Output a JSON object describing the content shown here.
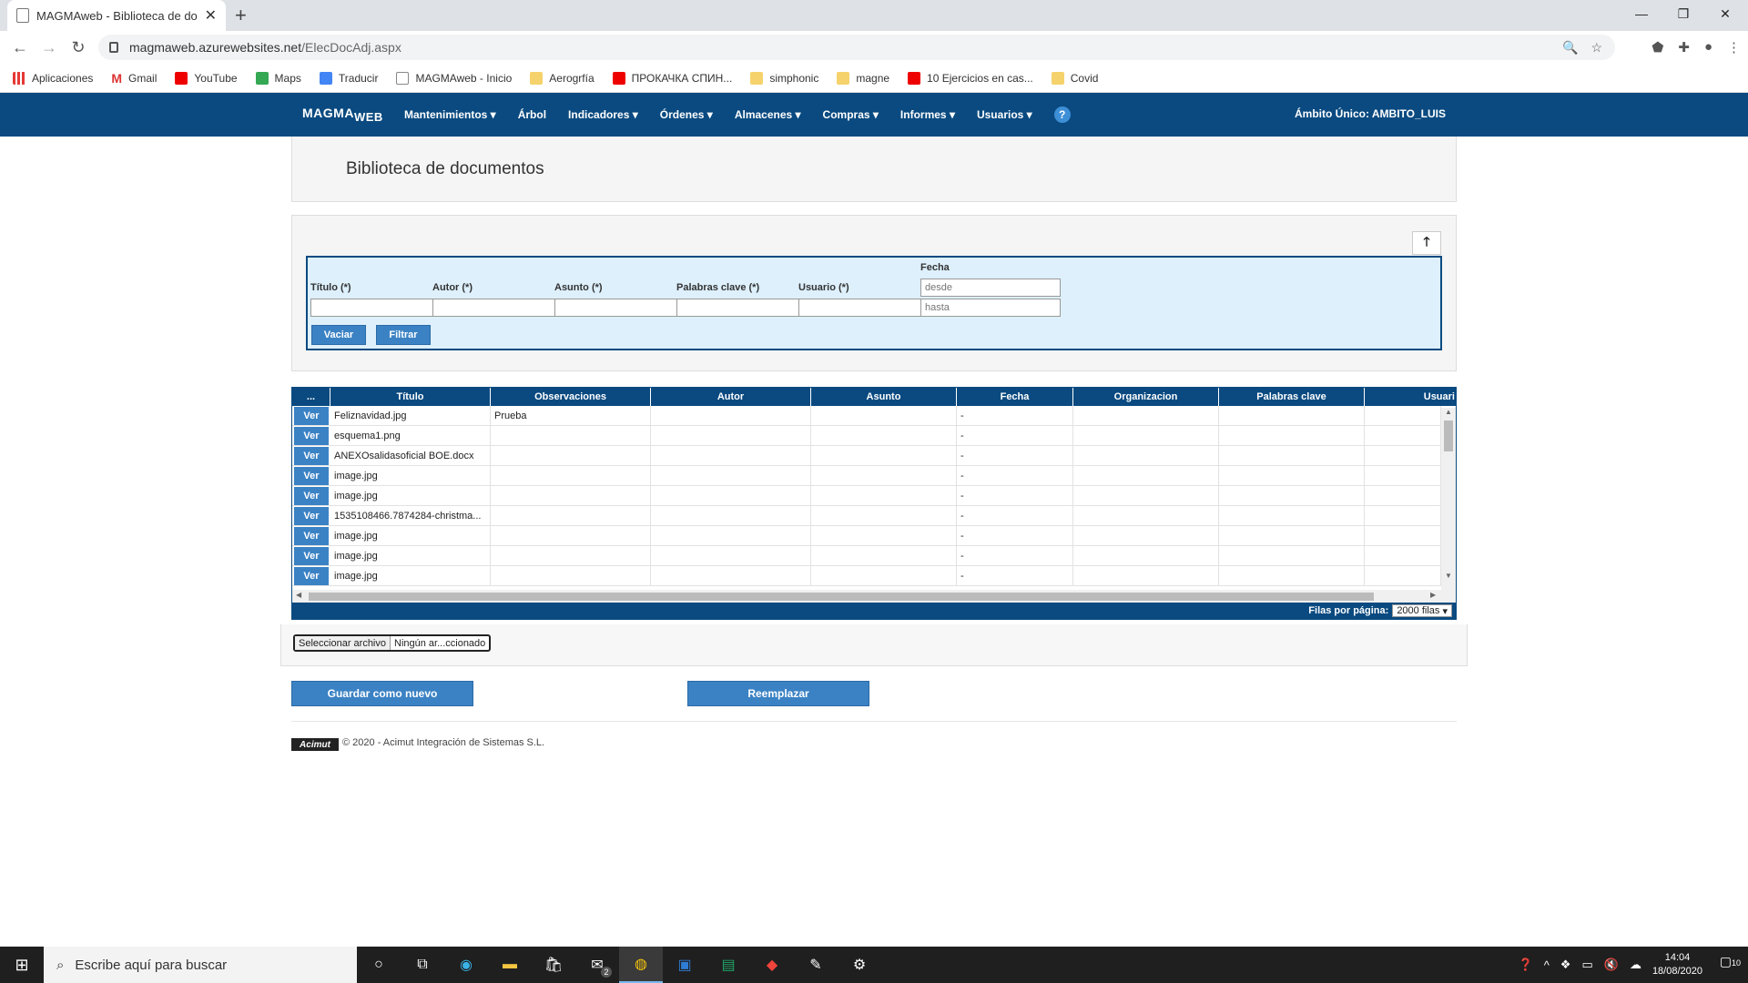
{
  "browser": {
    "tab_title": "MAGMAweb - Biblioteca de doc",
    "url_host": "magmaweb.azurewebsites.net",
    "url_path": "/ElecDocAdj.aspx",
    "bookmarks": [
      {
        "label": "Aplicaciones",
        "icon": "apps-icon"
      },
      {
        "label": "Gmail",
        "icon": "gmail-icon"
      },
      {
        "label": "YouTube",
        "icon": "youtube-icon"
      },
      {
        "label": "Maps",
        "icon": "maps-icon"
      },
      {
        "label": "Traducir",
        "icon": "translate-icon"
      },
      {
        "label": "MAGMAweb - Inicio",
        "icon": "page-icon"
      },
      {
        "label": "Aerogrfía",
        "icon": "folder-icon"
      },
      {
        "label": "ПРОКАЧКА СПИН...",
        "icon": "youtube-icon"
      },
      {
        "label": "simphonic",
        "icon": "folder-icon"
      },
      {
        "label": "magne",
        "icon": "folder-icon"
      },
      {
        "label": "10 Ejercicios en cas...",
        "icon": "youtube-icon"
      },
      {
        "label": "Covid",
        "icon": "folder-icon"
      }
    ]
  },
  "app": {
    "logo_main": "MAGMA",
    "logo_sub": "WEB",
    "menu": [
      "Mantenimientos",
      "Árbol",
      "Indicadores",
      "Órdenes",
      "Almacenes",
      "Compras",
      "Informes",
      "Usuarios"
    ],
    "menu_dropdown": [
      true,
      false,
      true,
      true,
      true,
      true,
      true,
      true
    ],
    "help": "?",
    "ambito": "Ámbito Único: AMBITO_LUIS"
  },
  "page": {
    "title": "Biblioteca de documentos"
  },
  "filters": {
    "titulo_label": "Título (*)",
    "autor_label": "Autor (*)",
    "asunto_label": "Asunto (*)",
    "palabras_label": "Palabras clave (*)",
    "usuario_label": "Usuario (*)",
    "fecha_label": "Fecha",
    "desde_placeholder": "desde",
    "hasta_placeholder": "hasta",
    "vaciar": "Vaciar",
    "filtrar": "Filtrar"
  },
  "grid": {
    "columns": [
      "...",
      "Título",
      "Observaciones",
      "Autor",
      "Asunto",
      "Fecha",
      "Organizacion",
      "Palabras clave",
      "Usuari"
    ],
    "ver_label": "Ver",
    "rows": [
      {
        "titulo": "Feliznavidad.jpg",
        "observaciones": "Prueba",
        "fecha": "-"
      },
      {
        "titulo": "esquema1.png",
        "observaciones": "",
        "fecha": "-"
      },
      {
        "titulo": "ANEXOsalidasoficial BOE.docx",
        "observaciones": "",
        "fecha": "-"
      },
      {
        "titulo": "image.jpg",
        "observaciones": "",
        "fecha": "-"
      },
      {
        "titulo": "image.jpg",
        "observaciones": "",
        "fecha": "-"
      },
      {
        "titulo": "1535108466.7874284-christma...",
        "observaciones": "",
        "fecha": "-"
      },
      {
        "titulo": "image.jpg",
        "observaciones": "",
        "fecha": "-"
      },
      {
        "titulo": "image.jpg",
        "observaciones": "",
        "fecha": "-"
      },
      {
        "titulo": "image.jpg",
        "observaciones": "",
        "fecha": "-"
      }
    ],
    "rows_per_page_label": "Filas por página:",
    "rows_per_page_value": "2000 filas"
  },
  "upload": {
    "pick_label": "Seleccionar archivo",
    "file_name": "Ningún ar...ccionado"
  },
  "actions": {
    "save_new": "Guardar como nuevo",
    "replace": "Reemplazar"
  },
  "footer": {
    "brand": "Acimut",
    "copyright": "© 2020 - Acimut Integración de Sistemas S.L."
  },
  "taskbar": {
    "search_placeholder": "Escribe aquí para buscar",
    "mail_badge": "2",
    "time": "14:04",
    "date": "18/08/2020",
    "notifications": "10"
  },
  "colors": {
    "header": "#0a4a80",
    "button": "#3b82c4",
    "filter_bg": "#ddf0fc"
  }
}
